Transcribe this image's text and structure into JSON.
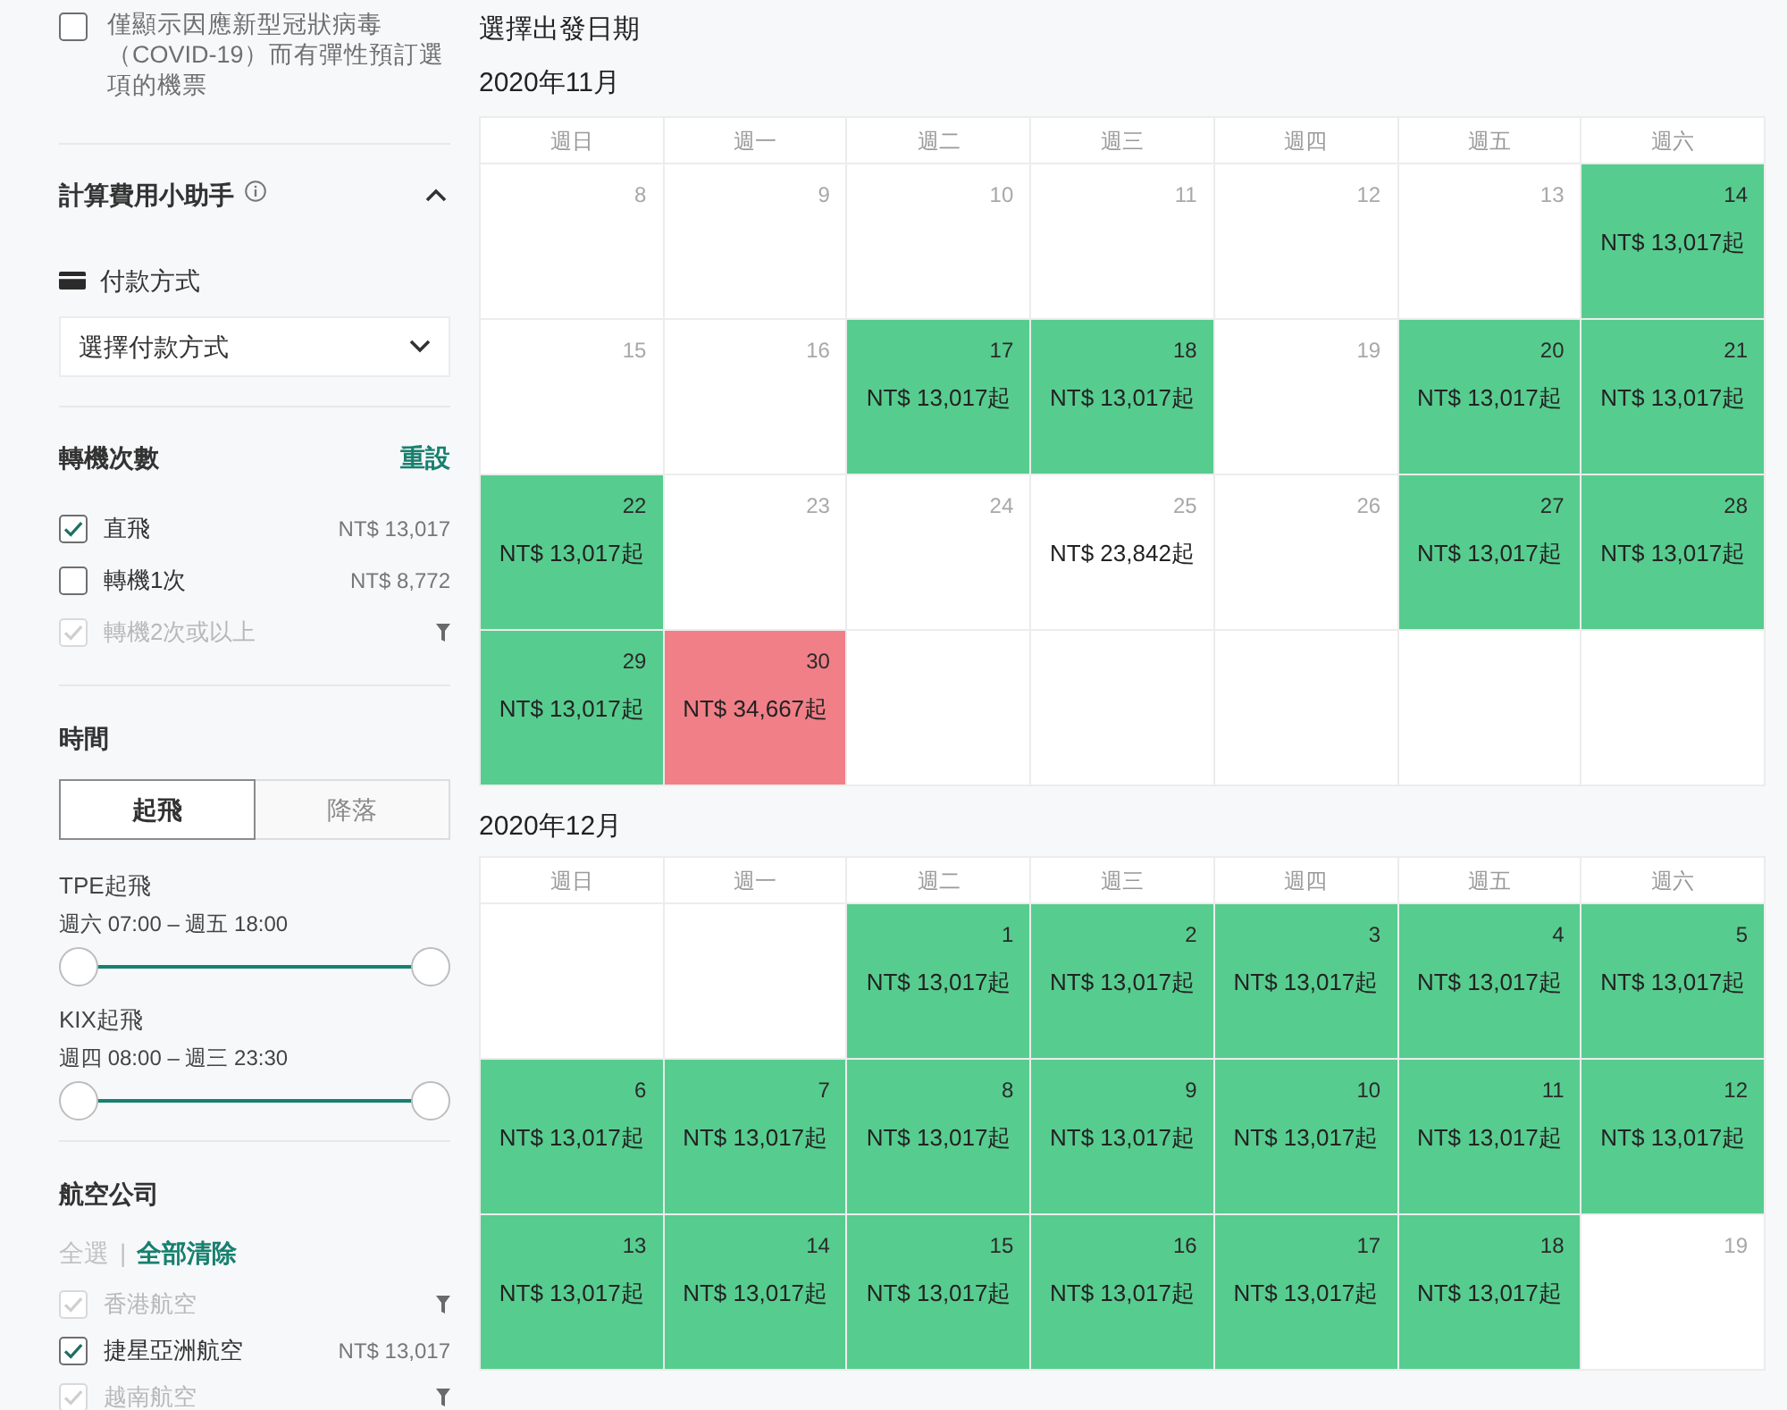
{
  "sidebar": {
    "covid_filter": {
      "label": "僅顯示因應新型冠狀病毒（COVID-19）而有彈性預訂選項的機票",
      "checked": false
    },
    "fee_helper": {
      "title": "計算費用小助手",
      "expanded": true,
      "payment_label": "付款方式",
      "payment_select": {
        "value": "選擇付款方式"
      }
    },
    "stops": {
      "title": "轉機次數",
      "reset": "重設",
      "options": [
        {
          "label": "直飛",
          "checked": true,
          "disabled": false,
          "kind": "price",
          "price": "NT$ 13,017"
        },
        {
          "label": "轉機1次",
          "checked": false,
          "disabled": false,
          "kind": "price",
          "price": "NT$ 8,772"
        },
        {
          "label": "轉機2次或以上",
          "checked": true,
          "disabled": true,
          "kind": "filter"
        }
      ]
    },
    "time": {
      "title": "時間",
      "tabs": [
        {
          "label": "起飛",
          "selected": true
        },
        {
          "label": "降落",
          "selected": false
        }
      ],
      "sliders": [
        {
          "label": "TPE起飛",
          "range": "週六 07:00 – 週五 18:00",
          "thumbs": [
            {
              "level": 0
            },
            {
              "level": 1
            }
          ]
        },
        {
          "label": "KIX起飛",
          "range": "週四 08:00 – 週三 23:30",
          "thumbs": [
            {
              "level": 0
            },
            {
              "level": 1
            }
          ]
        }
      ]
    },
    "airlines": {
      "title": "航空公司",
      "select_all": {
        "label": "全選",
        "disabled": true
      },
      "separator": "|",
      "clear_all": {
        "label": "全部清除",
        "disabled": false
      },
      "options": [
        {
          "label": "香港航空",
          "checked": true,
          "disabled": true,
          "kind": "filter"
        },
        {
          "label": "捷星亞洲航空",
          "checked": true,
          "disabled": false,
          "kind": "price",
          "price": "NT$ 13,017"
        },
        {
          "label": "越南航空",
          "checked": true,
          "disabled": true,
          "kind": "filter"
        }
      ]
    }
  },
  "calendar": {
    "title": "選擇出發日期",
    "months": [
      {
        "title": "2020年11月",
        "weekdays": [
          "週日",
          "週一",
          "週二",
          "週三",
          "週四",
          "週五",
          "週六"
        ],
        "weeks": [
          [
            {
              "kind": "day",
              "day": "8"
            },
            {
              "kind": "day",
              "day": "9"
            },
            {
              "kind": "day",
              "day": "10"
            },
            {
              "kind": "day",
              "day": "11"
            },
            {
              "kind": "day",
              "day": "12"
            },
            {
              "kind": "day",
              "day": "13"
            },
            {
              "kind": "day",
              "day": "14",
              "price": "NT$ 13,017起",
              "color": "#57cc8f"
            }
          ],
          [
            {
              "kind": "day",
              "day": "15"
            },
            {
              "kind": "day",
              "day": "16"
            },
            {
              "kind": "day",
              "day": "17",
              "price": "NT$ 13,017起",
              "color": "#57cc8f"
            },
            {
              "kind": "day",
              "day": "18",
              "price": "NT$ 13,017起",
              "color": "#57cc8f"
            },
            {
              "kind": "day",
              "day": "19"
            },
            {
              "kind": "day",
              "day": "20",
              "price": "NT$ 13,017起",
              "color": "#57cc8f"
            },
            {
              "kind": "day",
              "day": "21",
              "price": "NT$ 13,017起",
              "color": "#57cc8f"
            }
          ],
          [
            {
              "kind": "day",
              "day": "22",
              "price": "NT$ 13,017起",
              "color": "#57cc8f"
            },
            {
              "kind": "day",
              "day": "23"
            },
            {
              "kind": "day",
              "day": "24"
            },
            {
              "kind": "day",
              "day": "25",
              "price": "NT$ 23,842起"
            },
            {
              "kind": "day",
              "day": "26"
            },
            {
              "kind": "day",
              "day": "27",
              "price": "NT$ 13,017起",
              "color": "#57cc8f"
            },
            {
              "kind": "day",
              "day": "28",
              "price": "NT$ 13,017起",
              "color": "#57cc8f"
            }
          ],
          [
            {
              "kind": "day",
              "day": "29",
              "price": "NT$ 13,017起",
              "color": "#57cc8f"
            },
            {
              "kind": "day",
              "day": "30",
              "price": "NT$ 34,667起",
              "color": "#f07f88"
            },
            {
              "kind": "blank"
            },
            {
              "kind": "blank"
            },
            {
              "kind": "blank"
            },
            {
              "kind": "blank"
            },
            {
              "kind": "blank"
            }
          ]
        ]
      },
      {
        "title": "2020年12月",
        "weekdays": [
          "週日",
          "週一",
          "週二",
          "週三",
          "週四",
          "週五",
          "週六"
        ],
        "weeks": [
          [
            {
              "kind": "blank"
            },
            {
              "kind": "blank"
            },
            {
              "kind": "day",
              "day": "1",
              "price": "NT$ 13,017起",
              "color": "#57cc8f"
            },
            {
              "kind": "day",
              "day": "2",
              "price": "NT$ 13,017起",
              "color": "#57cc8f"
            },
            {
              "kind": "day",
              "day": "3",
              "price": "NT$ 13,017起",
              "color": "#57cc8f"
            },
            {
              "kind": "day",
              "day": "4",
              "price": "NT$ 13,017起",
              "color": "#57cc8f"
            },
            {
              "kind": "day",
              "day": "5",
              "price": "NT$ 13,017起",
              "color": "#57cc8f"
            }
          ],
          [
            {
              "kind": "day",
              "day": "6",
              "price": "NT$ 13,017起",
              "color": "#57cc8f"
            },
            {
              "kind": "day",
              "day": "7",
              "price": "NT$ 13,017起",
              "color": "#57cc8f"
            },
            {
              "kind": "day",
              "day": "8",
              "price": "NT$ 13,017起",
              "color": "#57cc8f"
            },
            {
              "kind": "day",
              "day": "9",
              "price": "NT$ 13,017起",
              "color": "#57cc8f"
            },
            {
              "kind": "day",
              "day": "10",
              "price": "NT$ 13,017起",
              "color": "#57cc8f"
            },
            {
              "kind": "day",
              "day": "11",
              "price": "NT$ 13,017起",
              "color": "#57cc8f"
            },
            {
              "kind": "day",
              "day": "12",
              "price": "NT$ 13,017起",
              "color": "#57cc8f"
            }
          ],
          [
            {
              "kind": "day",
              "day": "13",
              "price": "NT$ 13,017起",
              "color": "#57cc8f"
            },
            {
              "kind": "day",
              "day": "14",
              "price": "NT$ 13,017起",
              "color": "#57cc8f"
            },
            {
              "kind": "day",
              "day": "15",
              "price": "NT$ 13,017起",
              "color": "#57cc8f"
            },
            {
              "kind": "day",
              "day": "16",
              "price": "NT$ 13,017起",
              "color": "#57cc8f"
            },
            {
              "kind": "day",
              "day": "17",
              "price": "NT$ 13,017起",
              "color": "#57cc8f"
            },
            {
              "kind": "day",
              "day": "18",
              "price": "NT$ 13,017起",
              "color": "#57cc8f"
            },
            {
              "kind": "day",
              "day": "19"
            }
          ]
        ]
      }
    ]
  }
}
